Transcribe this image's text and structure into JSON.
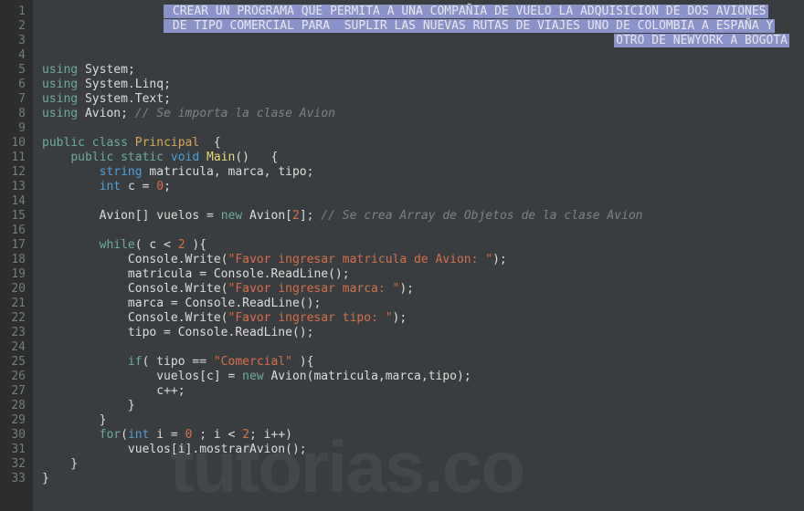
{
  "lineNumbers": [
    "1",
    "2",
    "3",
    "4",
    "5",
    "6",
    "7",
    "8",
    "9",
    "10",
    "11",
    "12",
    "13",
    "14",
    "15",
    "16",
    "17",
    "18",
    "19",
    "20",
    "21",
    "22",
    "23",
    "24",
    "25",
    "26",
    "27",
    "28",
    "29",
    "30",
    "31",
    "32",
    "33"
  ],
  "header": {
    "l1": " CREAR UN PROGRAMA QUE PERMITA A UNA COMPAÑIA DE VUELO LA ADQUISICION DE DOS AVIONES",
    "l2": " DE TIPO COMERCIAL PARA  SUPLIR LAS NUEVAS RUTAS DE VIAJES UNO DE COLOMBIA A ESPAÑA Y",
    "l3": "OTRO DE NEWYORK A BOGOTA"
  },
  "tokens": {
    "using": "using",
    "public": "public",
    "class": "class",
    "static": "static",
    "void": "void",
    "string": "string",
    "int": "int",
    "new": "new",
    "while": "while",
    "if": "if",
    "for": "for",
    "system": "System",
    "linq": "System.Linq",
    "text": "System.Text",
    "avion": "Avion",
    "principal": "Principal",
    "main": "Main",
    "console": "Console",
    "write": "Write",
    "readline": "ReadLine",
    "mostrarAvion": "mostrarAvion",
    "matricula": "matricula",
    "marca": "marca",
    "tipo": "tipo",
    "vuelos": "vuelos",
    "c": "c",
    "i": "i"
  },
  "numbers": {
    "zero": "0",
    "two": "2"
  },
  "strings": {
    "favMatricula": "\"Favor ingresar matricula de Avion: \"",
    "favMarca": "\"Favor ingresar marca: \"",
    "favTipo": "\"Favor ingresar tipo: \"",
    "comercial": "\"Comercial\""
  },
  "comments": {
    "importAvion": "// Se importa la clase Avion",
    "creaArray": "// Se crea Array de Objetos de la clase Avion"
  },
  "watermark": "tutorias.co"
}
